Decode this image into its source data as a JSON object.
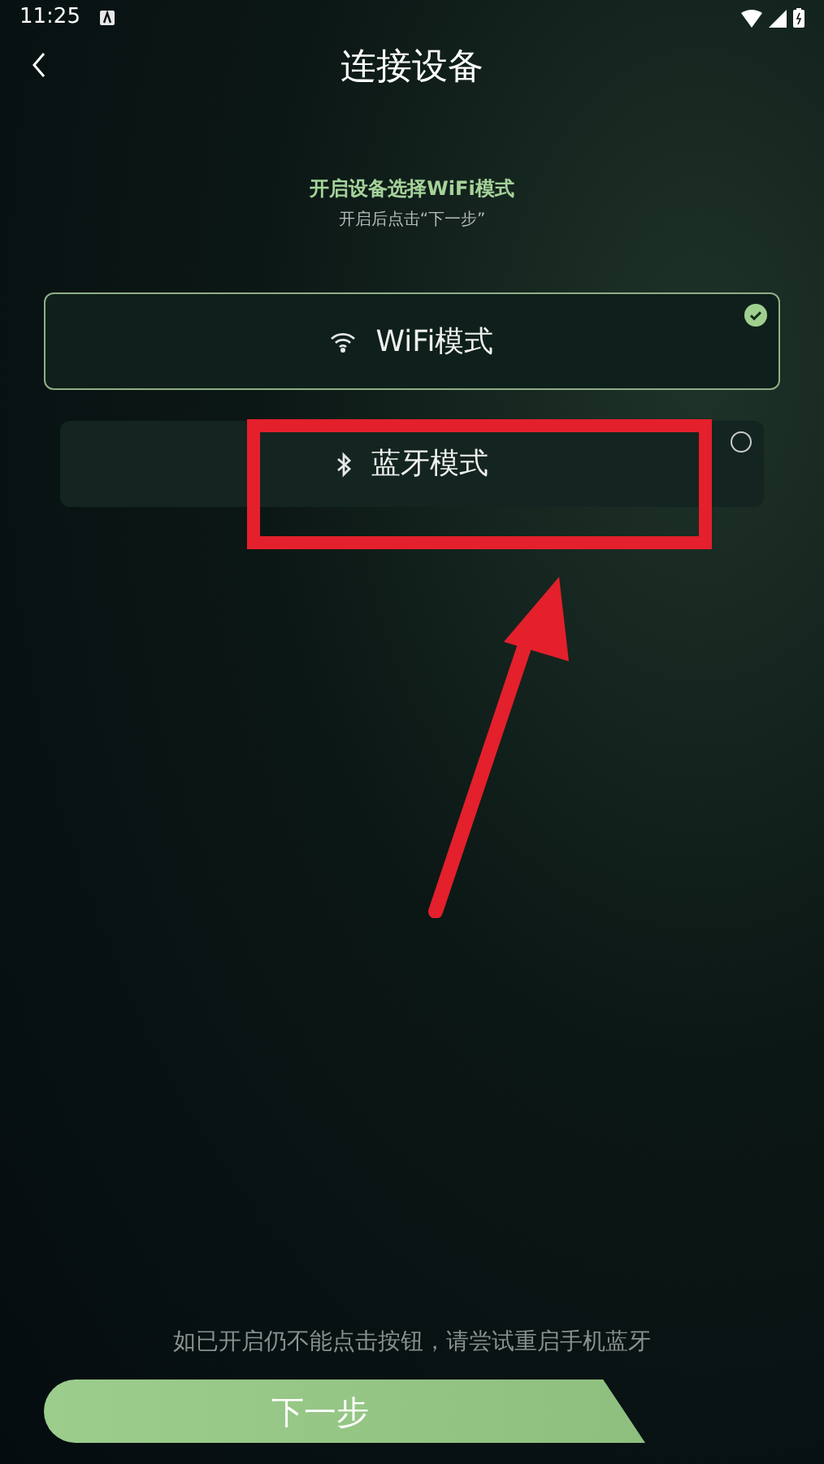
{
  "status_bar": {
    "time": "11:25"
  },
  "header": {
    "title": "连接设备"
  },
  "instruction": {
    "heading": "开启设备选择WiFi模式",
    "subtext": "开启后点击“下一步”"
  },
  "modes": [
    {
      "kind": "wifi",
      "label": "WiFi模式",
      "selected": true
    },
    {
      "kind": "bluetooth",
      "label": "蓝牙模式",
      "selected": false
    }
  ],
  "hint": "如已开启仍不能点击按钮，请尝试重启手机蓝牙",
  "next_button": "下一步"
}
